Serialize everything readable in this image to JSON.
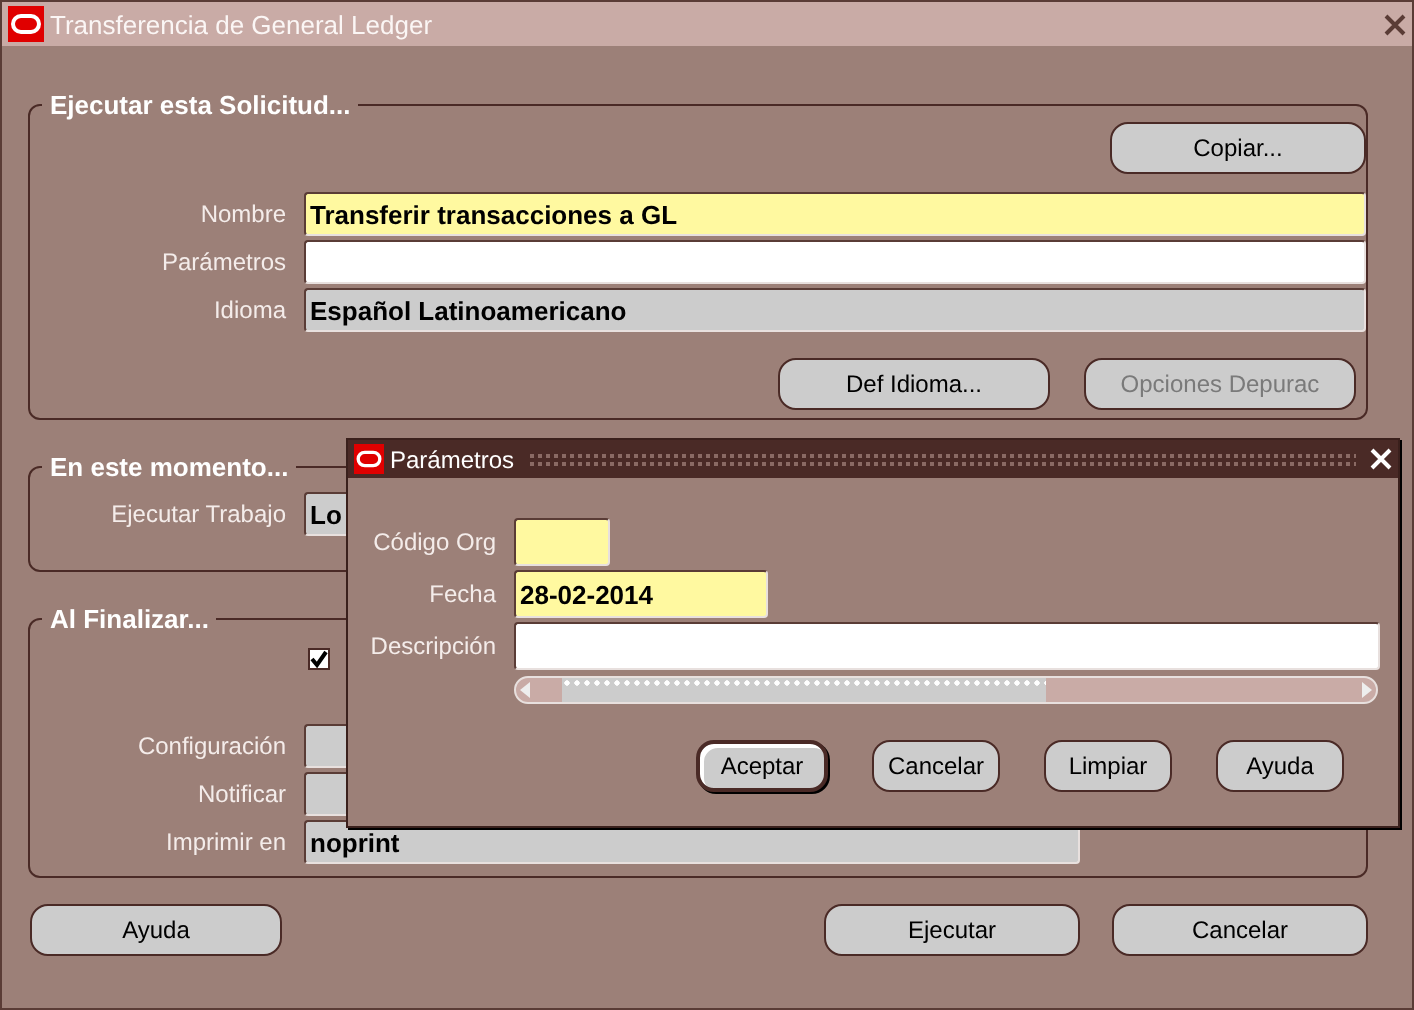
{
  "window": {
    "title": "Transferencia de General Ledger"
  },
  "request": {
    "title": "Ejecutar esta Solicitud...",
    "copy_button": {
      "label": "Copiar...",
      "disabled": false
    },
    "fields": [
      {
        "label": "Nombre",
        "value": "Transferir transacciones a GL",
        "kind": "required"
      },
      {
        "label": "Parámetros",
        "kind": "text"
      },
      {
        "label": "Idioma",
        "value": "Español Latinoamericano",
        "kind": "readonly"
      }
    ],
    "buttons": [
      {
        "label": "Def Idioma...",
        "disabled": false
      },
      {
        "label": "Opciones Depurac",
        "disabled": true
      }
    ]
  },
  "schedule": {
    "title": "En este momento...",
    "fields": [
      {
        "label": "Ejecutar Trabajo",
        "value": "Lo",
        "kind": "readonly"
      }
    ]
  },
  "completion": {
    "title": "Al Finalizar...",
    "checkbox": {
      "checked": true
    },
    "fields": [
      {
        "label": "Configuración",
        "kind": "readonly"
      },
      {
        "label": "Notificar",
        "kind": "readonly"
      },
      {
        "label": "Imprimir en",
        "value": "noprint",
        "kind": "readonly"
      }
    ]
  },
  "footer": {
    "help_button": {
      "label": "Ayuda"
    },
    "buttons": [
      {
        "label": "Ejecutar"
      },
      {
        "label": "Cancelar"
      }
    ]
  },
  "dialog": {
    "title": "Parámetros",
    "fields": [
      {
        "label": "Código Org",
        "kind": "required"
      },
      {
        "label": "Fecha",
        "value": "28-02-2014",
        "kind": "required"
      },
      {
        "label": "Descripción",
        "kind": "text"
      }
    ],
    "buttons": [
      {
        "label": "Aceptar",
        "default": true
      },
      {
        "label": "Cancelar",
        "default": false
      },
      {
        "label": "Limpiar",
        "default": false
      },
      {
        "label": "Ayuda",
        "default": false
      }
    ]
  }
}
